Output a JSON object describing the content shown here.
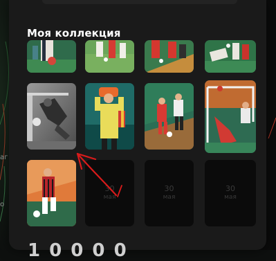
{
  "collection": {
    "title": "Моя коллекция"
  },
  "empty_slots": [
    {
      "day": "30",
      "month": "мая"
    },
    {
      "day": "30",
      "month": "мая"
    },
    {
      "day": "30",
      "month": "мая"
    }
  ],
  "edge_labels": [
    "аг",
    "о"
  ],
  "bottom": {
    "partial_text": "1 0 0 0 0"
  },
  "colors": {
    "panel": "#1a1a1a",
    "annotation_red": "#d91b1b"
  }
}
